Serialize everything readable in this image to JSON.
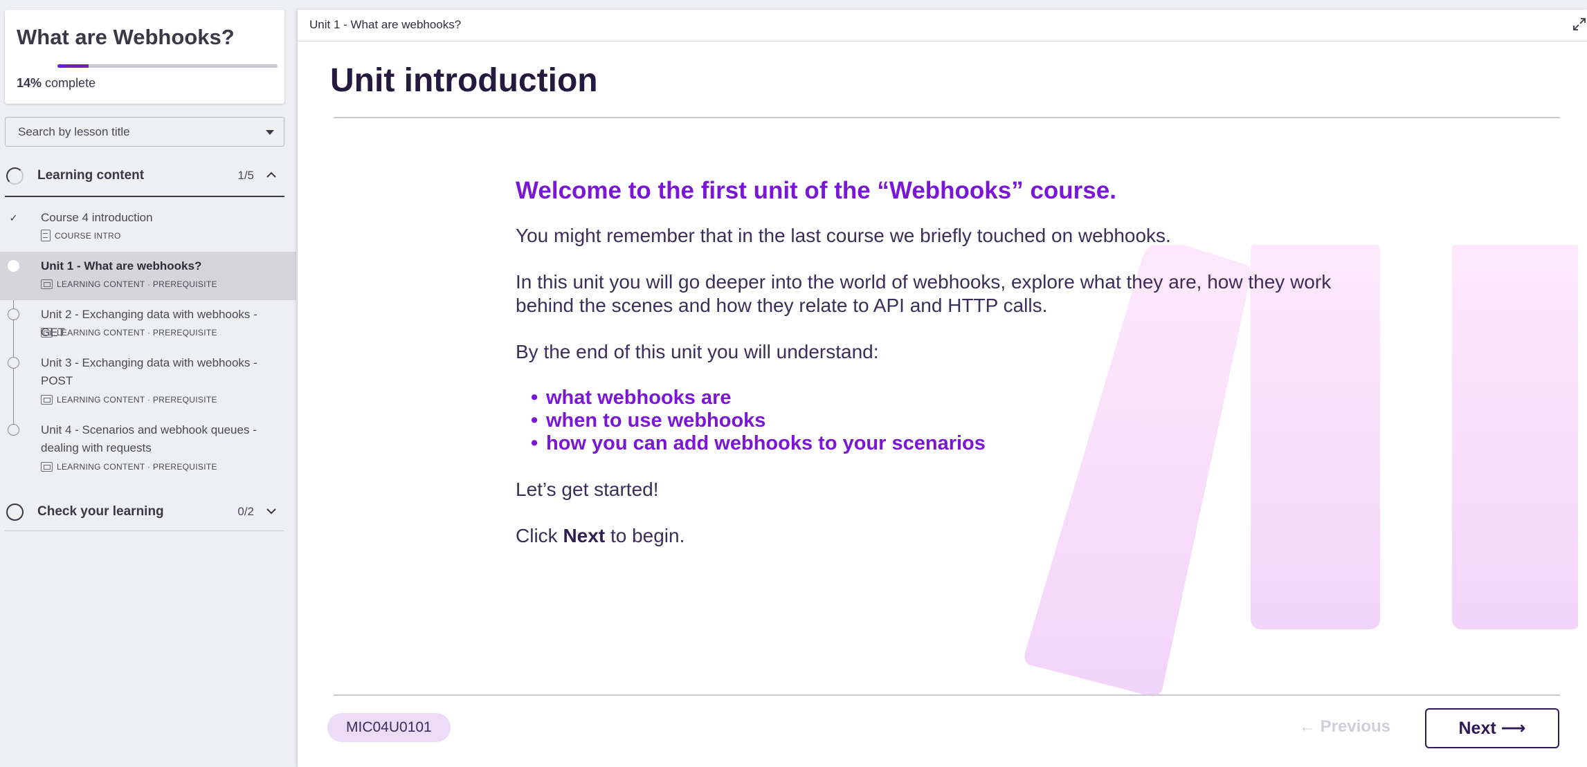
{
  "sidebar": {
    "course_title": "What are Webhooks?",
    "progress_percent": 14,
    "progress_value": "14%",
    "progress_suffix": "complete",
    "search_placeholder": "Search by lesson title",
    "sections": [
      {
        "title": "Learning content",
        "count": "1/5",
        "expanded": true,
        "lessons": [
          {
            "title": "Course 4 introduction",
            "meta": "COURSE INTRO",
            "completed": true,
            "active": false
          },
          {
            "title": "Unit 1 - What are webhooks?",
            "meta": "LEARNING CONTENT · PREREQUISITE",
            "completed": false,
            "active": true
          },
          {
            "title": "Unit 2 - Exchanging data with webhooks - GET",
            "meta": "LEARNING CONTENT · PREREQUISITE",
            "completed": false,
            "active": false
          },
          {
            "title": "Unit 3 - Exchanging data with webhooks - POST",
            "meta": "LEARNING CONTENT · PREREQUISITE",
            "completed": false,
            "active": false
          },
          {
            "title": "Unit 4 - Scenarios and webhook queues - dealing with requests",
            "meta": "LEARNING CONTENT · PREREQUISITE",
            "completed": false,
            "active": false
          }
        ]
      },
      {
        "title": "Check your learning",
        "count": "0/2",
        "expanded": false
      }
    ]
  },
  "main": {
    "breadcrumb": "Unit 1 - What are webhooks?",
    "heading": "Unit introduction",
    "welcome": "Welcome to the first unit of the “Webhooks” course.",
    "para1": "You might remember that in the last course we briefly touched on webhooks.",
    "para2": "In this unit you will go deeper into the world of webhooks, explore what they are, how they work behind the scenes and how they relate to API and HTTP calls.",
    "para3": "By the end of this unit you will understand:",
    "bullets": [
      "what webhooks are",
      "when to use webhooks",
      "how you can add webhooks to your scenarios"
    ],
    "para4": "Let’s get started!",
    "click_prefix": "Click",
    "click_bold": "Next",
    "click_suffix": "to begin.",
    "lesson_code": "MIC04U0101",
    "prev_label": "← Previous",
    "next_label": "Next ⟶"
  },
  "colors": {
    "accent": "#7a16d6",
    "heading": "#231a3d",
    "sidebar_bg": "#eeeff2",
    "active_row": "#d5d5db",
    "pill_bg": "#ecdcf8"
  },
  "icons": {
    "section_progress": "progress-ring-icon",
    "chevron_up": "chevron-up-icon",
    "chevron_down": "chevron-down-icon",
    "expand": "expand-icon",
    "lesson_type": "slides-icon",
    "course_intro": "document-icon",
    "completed": "checkmark-icon"
  }
}
